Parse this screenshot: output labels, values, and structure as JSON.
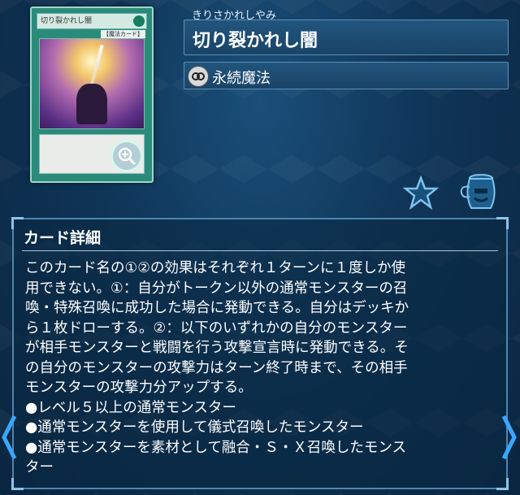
{
  "card": {
    "thumbnail_name": "切り裂かれし闇",
    "thumbnail_type": "【魔法カード】",
    "furigana": "きりさかれしやみ",
    "name": "切り裂かれし闇",
    "type_icon": "continuous-spell-icon",
    "type_label": "永続魔法"
  },
  "actions": {
    "zoom_icon": "zoom-in-icon",
    "favorite_icon": "star-icon",
    "deck_icon": "pot-icon"
  },
  "detail": {
    "title": "カード詳細",
    "effect_lines": [
      "このカード名の①②の効果はそれぞれ１ターンに１度しか使",
      "用できない。①：自分がトークン以外の通常モンスターの召",
      "喚・特殊召喚に成功した場合に発動できる。自分はデッキか",
      "ら１枚ドローする。②：以下のいずれかの自分のモンスター",
      "が相手モンスターと戦闘を行う攻撃宣言時に発動できる。そ",
      "の自分のモンスターの攻撃力はターン終了時まで、その相手",
      "モンスターの攻撃力分アップする。"
    ],
    "bullets": [
      "●レベル５以上の通常モンスター",
      "●通常モンスターを使用して儀式召喚したモンスター",
      "●通常モンスターを素材として融合・Ｓ・Ｘ召喚したモンス",
      "ター"
    ]
  },
  "navigation": {
    "prev_icon": "chevron-left-icon",
    "next_icon": "chevron-right-icon"
  },
  "colors": {
    "background": "#0f3557",
    "panel_border": "#4f85ad",
    "card_frame": "#2a8b7a"
  }
}
